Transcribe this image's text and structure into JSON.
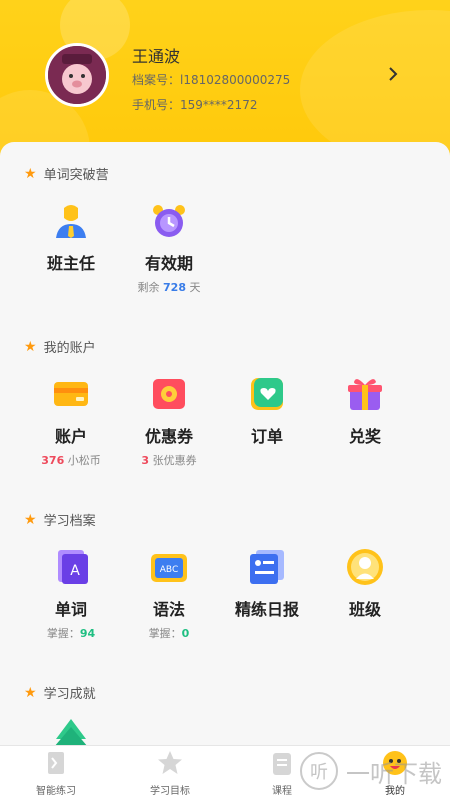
{
  "profile": {
    "name": "王通波",
    "file_label": "档案号：",
    "file_no": "l18102800000275",
    "phone_label": "手机号：",
    "phone": "159****2172"
  },
  "sections": [
    {
      "title": "单词突破营",
      "items": [
        {
          "label": "班主任",
          "icon": "head-teacher-icon"
        },
        {
          "label": "有效期",
          "icon": "alarm-clock-icon",
          "sub_pre": "剩余 ",
          "sub_num": "728",
          "sub_post": " 天"
        }
      ]
    },
    {
      "title": "我的账户",
      "items": [
        {
          "label": "账户",
          "icon": "wallet-icon",
          "sub_num": "376",
          "sub_post": " 小松币"
        },
        {
          "label": "优惠券",
          "icon": "coupon-icon",
          "sub_num": "3",
          "sub_post": " 张优惠券"
        },
        {
          "label": "订单",
          "icon": "order-heart-icon"
        },
        {
          "label": "兑奖",
          "icon": "gift-icon"
        }
      ]
    },
    {
      "title": "学习档案",
      "items": [
        {
          "label": "单词",
          "icon": "word-book-icon",
          "sub_pre": "掌握：",
          "sub_num": "94"
        },
        {
          "label": "语法",
          "icon": "abc-board-icon",
          "sub_pre": "掌握：",
          "sub_num": "0"
        },
        {
          "label": "精练日报",
          "icon": "daily-report-icon"
        },
        {
          "label": "班级",
          "icon": "class-icon"
        }
      ]
    },
    {
      "title": "学习成就",
      "items": []
    }
  ],
  "tabs": [
    {
      "label": "智能练习",
      "icon": "practice-icon"
    },
    {
      "label": "学习目标",
      "icon": "star-icon"
    },
    {
      "label": "课程",
      "icon": "course-icon"
    },
    {
      "label": "我的",
      "icon": "mine-icon",
      "active": true
    }
  ],
  "watermark": "一听下载",
  "watermark_icon": "听",
  "colors": {
    "header": "#ffcc0f",
    "star": "#ff9a0e",
    "blue": "#3a7de8",
    "red": "#ee4a5c",
    "green": "#1fbf82"
  }
}
